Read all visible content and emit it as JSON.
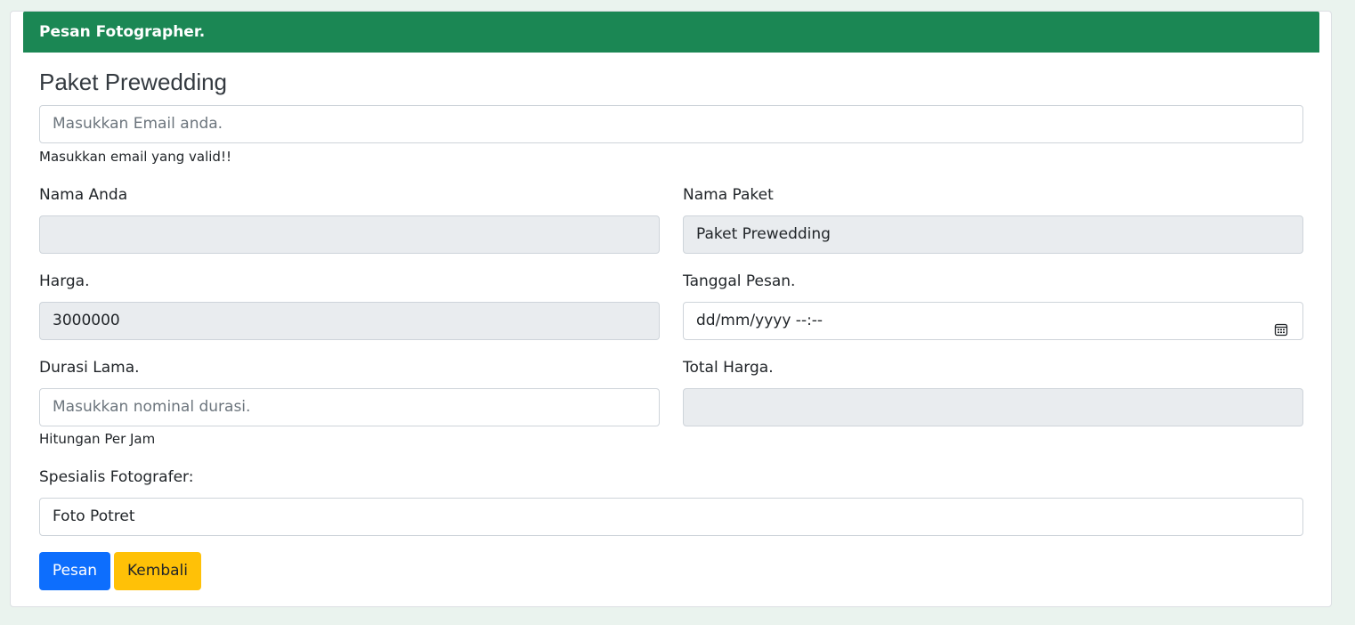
{
  "card": {
    "header": "Pesan Fotographer.",
    "title": "Paket Prewedding"
  },
  "email": {
    "placeholder": "Masukkan Email anda.",
    "hint": "Masukkan email yang valid!!"
  },
  "nama_anda": {
    "label": "Nama Anda",
    "value": ""
  },
  "nama_paket": {
    "label": "Nama Paket",
    "value": "Paket Prewedding"
  },
  "harga": {
    "label": "Harga.",
    "value": "3000000"
  },
  "tanggal": {
    "label": "Tanggal Pesan.",
    "value": "dd/mm/yyyy --:--",
    "icon": "calendar-icon"
  },
  "durasi": {
    "label": "Durasi Lama.",
    "placeholder": "Masukkan nominal durasi.",
    "hint": "Hitungan Per Jam"
  },
  "total": {
    "label": "Total Harga.",
    "value": ""
  },
  "spesialis": {
    "label": "Spesialis Fotografer:",
    "value": "Foto Potret"
  },
  "buttons": {
    "submit": "Pesan",
    "back": "Kembali"
  },
  "colors": {
    "header_bg": "#1b8754",
    "primary": "#0d6efd",
    "warning": "#ffc107",
    "readonly_bg": "#e9ecef"
  }
}
